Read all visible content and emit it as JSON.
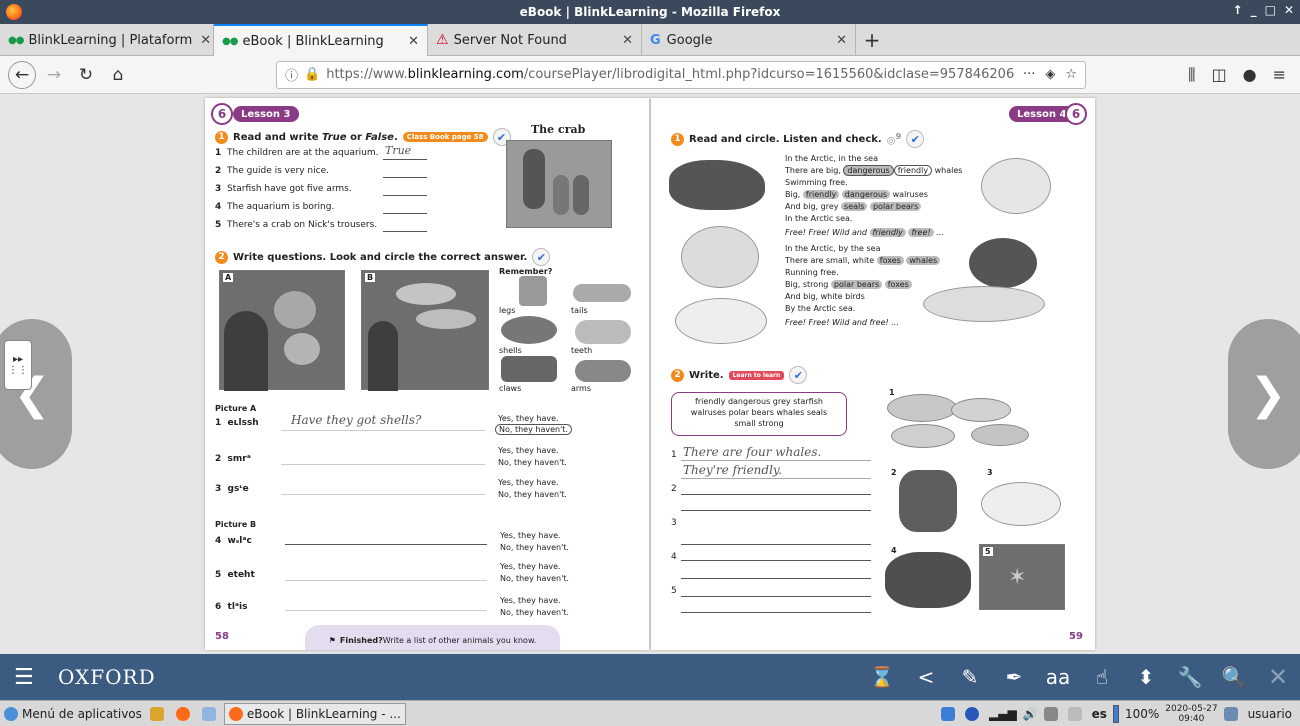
{
  "window": {
    "title": "eBook | BlinkLearning - Mozilla Firefox",
    "controls": [
      "↑",
      "_",
      "□",
      "✕"
    ]
  },
  "tabs": [
    {
      "label": "BlinkLearning | Plataform",
      "close": "✕"
    },
    {
      "label": "eBook | BlinkLearning",
      "close": "✕"
    },
    {
      "label": "Server Not Found",
      "close": "✕"
    },
    {
      "label": "Google",
      "close": "✕"
    }
  ],
  "newtab": "+",
  "nav": {
    "url_prefix": "https://www.",
    "url_domain": "blinklearning.com",
    "url_rest": "/coursePlayer/librodigital_html.php?idcurso=1615560&idclase=957846206",
    "more": "···"
  },
  "left_page": {
    "lesson": "Lesson 3",
    "unit": "6",
    "page_number": "58",
    "ex1": {
      "num": "1",
      "title_a": "Read and write ",
      "title_b": "True",
      "title_c": " or ",
      "title_d": "False",
      "title_e": ".",
      "tag": "Class Book page 58",
      "items": [
        {
          "num": "1",
          "text": "The children are at the aquarium.",
          "answer": "True"
        },
        {
          "num": "2",
          "text": "The guide is very nice.",
          "answer": ""
        },
        {
          "num": "3",
          "text": "Starfish have got five arms.",
          "answer": ""
        },
        {
          "num": "4",
          "text": "The aquarium is boring.",
          "answer": ""
        },
        {
          "num": "5",
          "text": "There's a crab on Nick's trousers.",
          "answer": ""
        }
      ]
    },
    "story_title": "The crab",
    "ex2": {
      "num": "2",
      "title": "Write questions. Look and circle the correct answer.",
      "pic_a": "A",
      "pic_b": "B",
      "remember": "Remember?",
      "words": [
        "legs",
        "tails",
        "shells",
        "teeth",
        "claws",
        "arms"
      ],
      "picture_a_label": "Picture A",
      "picture_b_label": "Picture B",
      "items": [
        {
          "num": "1",
          "scramble": "eʟlssh",
          "answer": "Have they got shells?",
          "yes": "Yes, they have.",
          "no": "No, they haven't."
        },
        {
          "num": "2",
          "scramble": "smrᵃ",
          "answer": "",
          "yes": "Yes, they have.",
          "no": "No, they haven't."
        },
        {
          "num": "3",
          "scramble": "gsᶫe",
          "answer": "",
          "yes": "Yes, they have.",
          "no": "No, they haven't."
        },
        {
          "num": "4",
          "scramble": "wₛlᵃc",
          "answer": "",
          "yes": "Yes, they have.",
          "no": "No, they haven't."
        },
        {
          "num": "5",
          "scramble": "eteht",
          "answer": "",
          "yes": "Yes, they have.",
          "no": "No, they haven't."
        },
        {
          "num": "6",
          "scramble": "tlᵃis",
          "answer": "",
          "yes": "Yes, they have.",
          "no": "No, they haven't."
        }
      ]
    },
    "finished_a": "Finished?",
    "finished_b": " Write a list of other animals you know."
  },
  "right_page": {
    "lesson": "Lesson 4",
    "unit": "6",
    "page_number": "59",
    "ex1": {
      "num": "1",
      "title": "Read and circle. Listen and check.",
      "audio": "9"
    },
    "poem": {
      "l1": "In the Arctic, in the sea",
      "l2a": "There are big, ",
      "l2b": "dangerous",
      "l2c": "friendly",
      "l2d": " whales",
      "l3": "Swimming free.",
      "l4a": "Big, ",
      "l4b": "friendly",
      "l4c": "dangerous",
      "l4d": " walruses",
      "l5a": "And big, grey ",
      "l5b": "seals",
      "l5c": "polar bears",
      "l6": "In the Arctic sea.",
      "l7a": "Free! Free! Wild and ",
      "l7b": "friendly",
      "l7c": "free!",
      "l7d": " ...",
      "l8": "In the Arctic, by the sea",
      "l9a": "There are small, white ",
      "l9b": "foxes",
      "l9c": "whales",
      "l10": "Running free.",
      "l11a": "Big, strong ",
      "l11b": "polar bears",
      "l11c": "foxes",
      "l12": "And big, white birds",
      "l13": "By the Arctic sea.",
      "l14": "Free! Free! Wild and free! ..."
    },
    "ex2": {
      "num": "2",
      "title": "Write.",
      "tag": "Learn to learn",
      "wordbox_l1": "friendly  dangerous  grey  starfish",
      "wordbox_l2": "walruses  polar bears  whales  seals",
      "wordbox_l3": "small  strong",
      "answer1a": "There are four whales.",
      "answer1b": "They're friendly.",
      "nums": [
        "1",
        "2",
        "3",
        "4",
        "5"
      ],
      "pic_nums": [
        "1",
        "2",
        "3",
        "4",
        "5"
      ]
    }
  },
  "app": {
    "brand": "OXFORD",
    "tools": [
      "⌛",
      "<",
      "✎",
      "✒",
      "aa",
      "☝",
      "⬍",
      "🔧",
      "🔍",
      "✕"
    ]
  },
  "taskbar": {
    "menu": "Menú de aplicativos",
    "window": "eBook | BlinkLearning - ...",
    "lang": "es",
    "battery": "100%",
    "date": "2020-05-27",
    "time": "09:40",
    "user": "usuario"
  }
}
